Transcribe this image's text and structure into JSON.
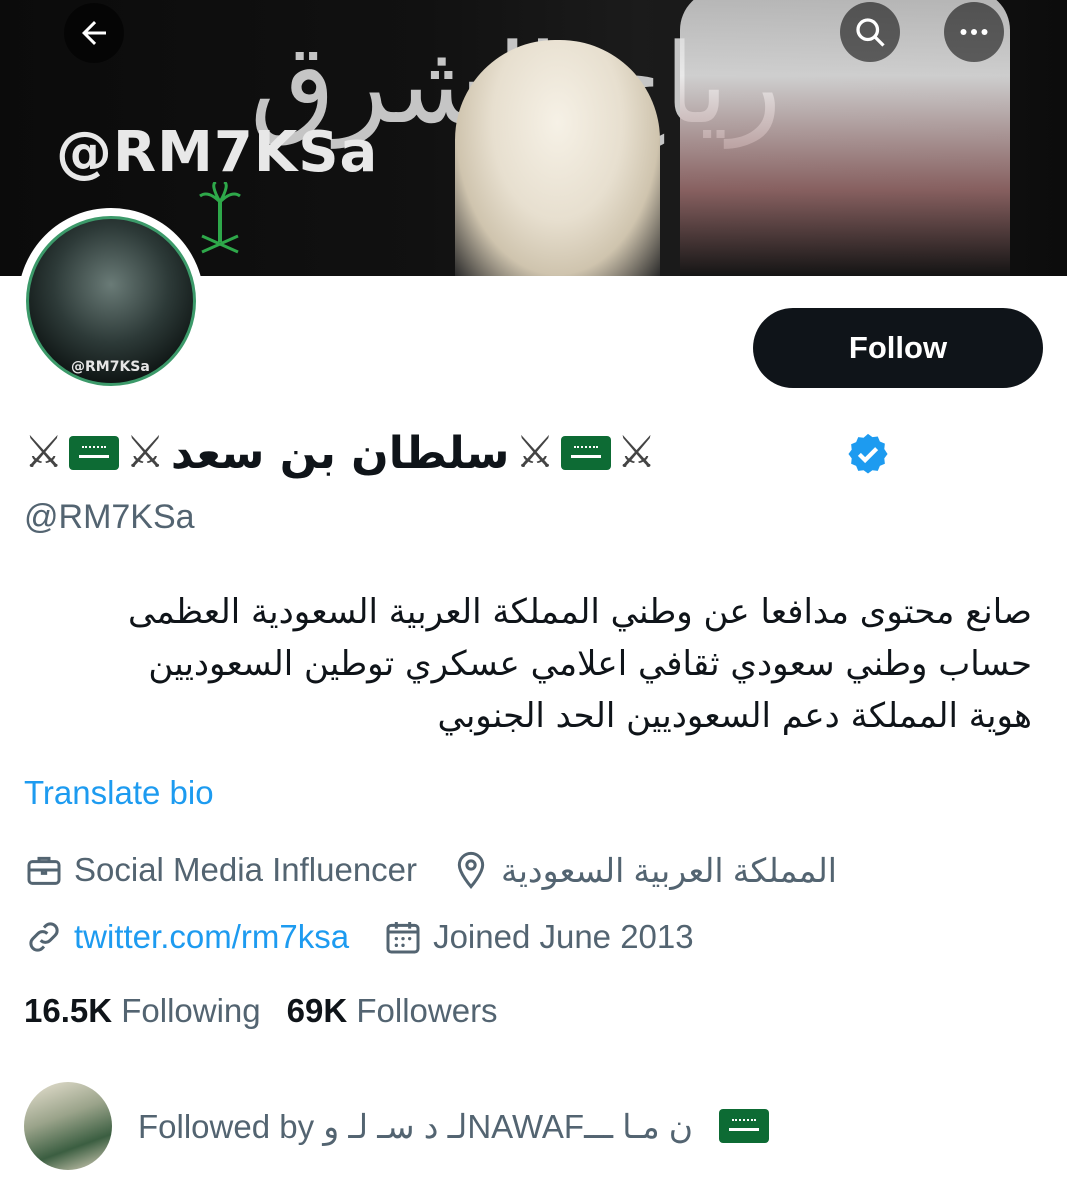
{
  "header": {
    "banner_arabic_text": "رياح الشرق",
    "banner_handle": "@RM7KSa",
    "back_icon": "arrow-left-icon",
    "search_icon": "search-icon",
    "more_icon": "more-horizontal-icon"
  },
  "profile": {
    "avatar_text": "@RM7KSa",
    "follow_label": "Follow",
    "display_name": "سلطان بن سعد",
    "emoji_left": "⚔️",
    "handle": "@RM7KSa",
    "bio_lines": [
      "صانع محتوى مدافعا عن وطني المملكة العربية السعودية العظمى",
      "حساب وطني سعودي ثقافي اعلامي عسكري توطين السعوديين",
      "هوية المملكة دعم السعوديين الحد الجنوبي"
    ],
    "translate_label": "Translate bio",
    "profession": "Social Media Influencer",
    "location": "المملكة العربية السعودية",
    "website": "twitter.com/rm7ksa",
    "joined": "Joined June 2013"
  },
  "stats": {
    "following_count": "16.5K",
    "following_label": "Following",
    "followers_count": "69K",
    "followers_label": "Followers"
  },
  "followed_by": {
    "text": "Followed by لـ د سـ لـ وNAWAFن مـا ـــ"
  },
  "colors": {
    "accent": "#1d9bf0",
    "text_primary": "#0f1419",
    "text_secondary": "#536471",
    "follow_button": "#0f1419",
    "flag_green": "#0d6b34"
  }
}
